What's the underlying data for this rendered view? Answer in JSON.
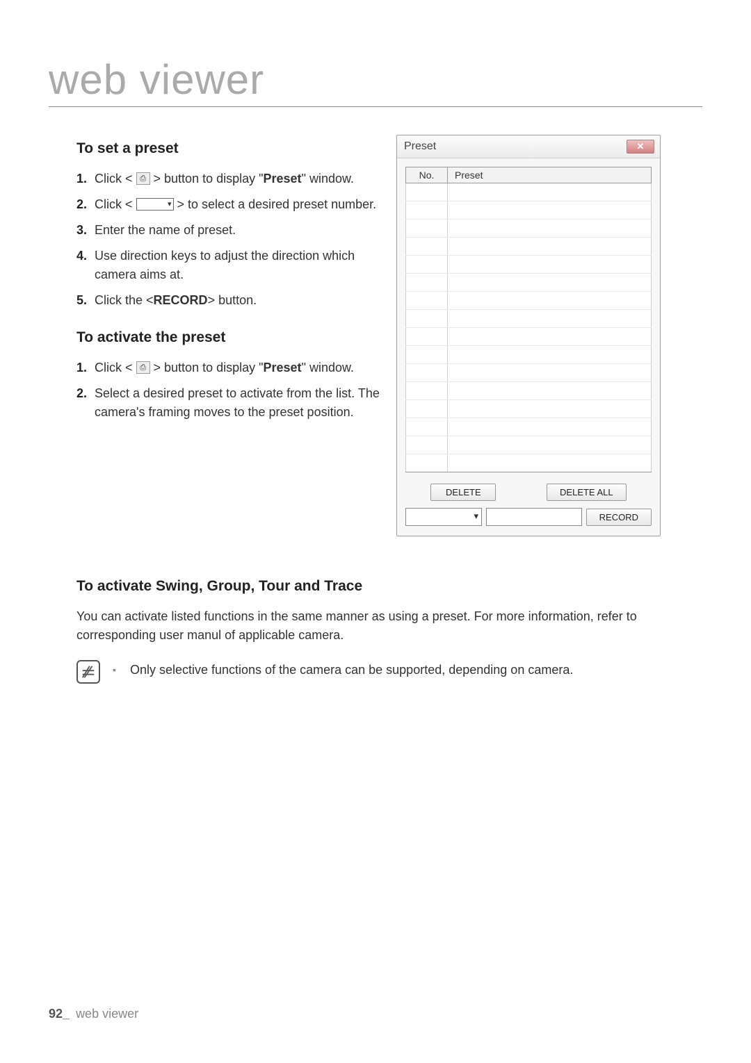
{
  "page_title": "web viewer",
  "sections": {
    "set_preset": {
      "heading": "To set a preset",
      "steps": [
        {
          "pre": "Click < ",
          "icon": "preset-icon",
          "post": " > button to display \"",
          "bold": "Preset",
          "tail": "\" window."
        },
        {
          "pre": "Click < ",
          "icon": "combo",
          "post": " > to select a desired preset number."
        },
        {
          "text": "Enter the name of preset."
        },
        {
          "text": "Use direction keys to adjust the direction which camera aims at."
        },
        {
          "pre": "Click the <",
          "bold": "RECORD",
          "tail": "> button."
        }
      ]
    },
    "activate_preset": {
      "heading": "To activate the preset",
      "steps": [
        {
          "pre": "Click < ",
          "icon": "preset-icon",
          "post": " > button to display \"",
          "bold": "Preset",
          "tail": "\" window."
        },
        {
          "text": "Select a desired preset to activate from the list. The camera's framing moves to the preset position."
        }
      ]
    },
    "swing": {
      "heading": "To activate Swing, Group, Tour and Trace",
      "body": "You can activate listed functions in the same manner as using a preset. For more information, refer to corresponding user manul of applicable camera.",
      "note": "Only selective functions of the camera can be supported, depending on camera."
    }
  },
  "preset_window": {
    "title": "Preset",
    "col_no": "No.",
    "col_preset": "Preset",
    "delete": "DELETE",
    "delete_all": "DELETE ALL",
    "record": "RECORD",
    "row_count": 16
  },
  "footer": {
    "page_number": "92_",
    "label": "web viewer"
  }
}
